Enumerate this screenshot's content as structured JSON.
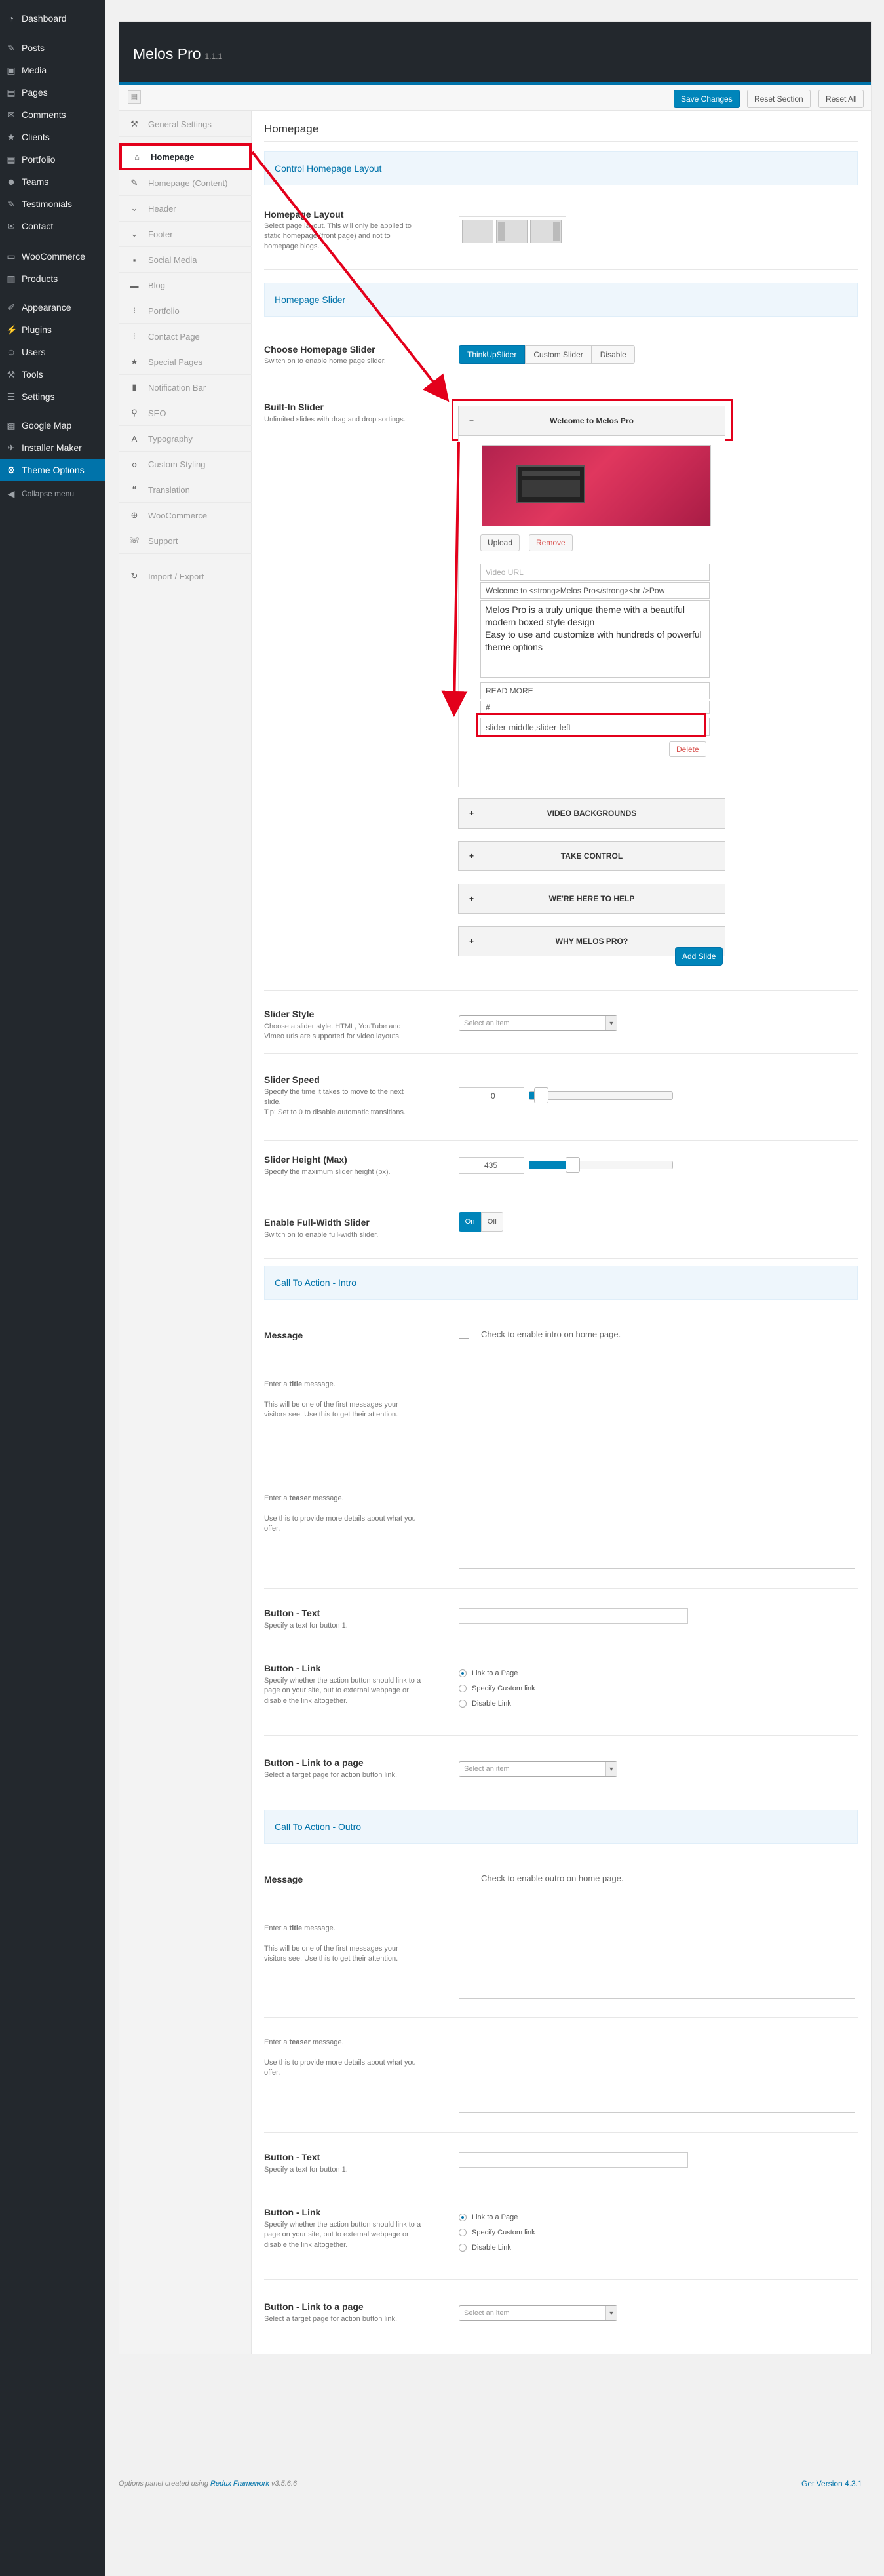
{
  "wp_menu": {
    "items": [
      {
        "label": "Dashboard",
        "icon": "dashboard-icon"
      },
      {
        "label": "Posts",
        "icon": "pin-icon"
      },
      {
        "label": "Media",
        "icon": "media-icon"
      },
      {
        "label": "Pages",
        "icon": "page-icon"
      },
      {
        "label": "Comments",
        "icon": "comment-icon"
      },
      {
        "label": "Clients",
        "icon": "star-icon"
      },
      {
        "label": "Portfolio",
        "icon": "portfolio-icon"
      },
      {
        "label": "Teams",
        "icon": "team-icon"
      },
      {
        "label": "Testimonials",
        "icon": "pin-icon"
      },
      {
        "label": "Contact",
        "icon": "mail-icon"
      },
      {
        "label": "WooCommerce",
        "icon": "woo-icon"
      },
      {
        "label": "Products",
        "icon": "products-icon"
      },
      {
        "label": "Appearance",
        "icon": "brush-icon"
      },
      {
        "label": "Plugins",
        "icon": "plugin-icon"
      },
      {
        "label": "Users",
        "icon": "user-icon"
      },
      {
        "label": "Tools",
        "icon": "wrench-icon"
      },
      {
        "label": "Settings",
        "icon": "settings-icon"
      },
      {
        "label": "Google Map",
        "icon": "map-icon"
      },
      {
        "label": "Installer Maker",
        "icon": "installer-icon"
      },
      {
        "label": "Theme Options",
        "icon": "gear-icon"
      },
      {
        "label": "Collapse menu",
        "icon": "collapse-icon"
      }
    ]
  },
  "header": {
    "title": "Melos Pro",
    "version": "1.1.1"
  },
  "toolbar": {
    "save": "Save Changes",
    "reset_section": "Reset Section",
    "reset_all": "Reset All"
  },
  "nav": {
    "items": [
      {
        "label": "General Settings",
        "icon": "wrench-icon"
      },
      {
        "label": "Homepage",
        "icon": "home-icon"
      },
      {
        "label": "Homepage (Content)",
        "icon": "pencil-icon"
      },
      {
        "label": "Header",
        "icon": "chevron-down-icon"
      },
      {
        "label": "Footer",
        "icon": "chevron-down-icon"
      },
      {
        "label": "Social Media",
        "icon": "social-icon"
      },
      {
        "label": "Blog",
        "icon": "comment-icon"
      },
      {
        "label": "Portfolio",
        "icon": "grid-icon"
      },
      {
        "label": "Contact Page",
        "icon": "grid-icon"
      },
      {
        "label": "Special Pages",
        "icon": "star-icon"
      },
      {
        "label": "Notification Bar",
        "icon": "bell-icon"
      },
      {
        "label": "SEO",
        "icon": "search-icon"
      },
      {
        "label": "Typography",
        "icon": "type-icon"
      },
      {
        "label": "Custom Styling",
        "icon": "code-icon"
      },
      {
        "label": "Translation",
        "icon": "quote-icon"
      },
      {
        "label": "WooCommerce",
        "icon": "cart-icon"
      },
      {
        "label": "Support",
        "icon": "support-icon"
      },
      {
        "label": "Import / Export",
        "icon": "refresh-icon"
      }
    ]
  },
  "main": {
    "page_title": "Homepage",
    "section_layout": "Control Homepage Layout",
    "layout_title": "Homepage Layout",
    "layout_desc": "Select page layout. This will only be applied to static homepage (front page) and not to homepage blogs.",
    "section_slider": "Homepage Slider",
    "choose_title": "Choose Homepage Slider",
    "choose_desc": "Switch on to enable home page slider.",
    "choose_options": [
      "ThinkUpSlider",
      "Custom Slider",
      "Disable"
    ],
    "builtin_title": "Built-In Slider",
    "builtin_desc": "Unlimited slides with drag and drop sortings.",
    "slide_open": "Welcome to Melos Pro",
    "upload": "Upload",
    "remove": "Remove",
    "video_placeholder": "Video URL",
    "slide_title_value": "Welcome to <strong>Melos Pro</strong><br />Pow",
    "slide_desc_value": "Melos Pro is a truly unique theme with a beautiful modern boxed style design\nEasy to use and customize with hundreds of powerful theme options",
    "slide_button_value": "READ MORE",
    "slide_link_value": "#",
    "slide_class_value": "slider-middle,slider-left",
    "delete": "Delete",
    "slides_collapsed": [
      "VIDEO BACKGROUNDS",
      "TAKE CONTROL",
      "WE'RE HERE TO HELP",
      "WHY MELOS PRO?"
    ],
    "add_slide": "Add Slide",
    "style_title": "Slider Style",
    "style_desc": "Choose a slider style. HTML, YouTube and Vimeo urls are supported for video layouts.",
    "select_placeholder": "Select an item",
    "speed_title": "Slider Speed",
    "speed_desc": "Specify the time it takes to move to the next slide.\nTip: Set to 0 to disable automatic transitions.",
    "speed_value": "0",
    "speed_fraction": 0,
    "height_title": "Slider Height (Max)",
    "height_desc": "Specify the maximum slider height (px).",
    "height_value": "435",
    "height_fraction": 0.25,
    "fullwidth_title": "Enable Full-Width Slider",
    "fullwidth_desc": "Switch on to enable full-width slider.",
    "on": "On",
    "off": "Off",
    "section_intro": "Call To Action - Intro",
    "message_title": "Message",
    "intro_check": "Check to enable intro on home page.",
    "title_msg_desc_a": "Enter a ",
    "title_msg_desc_b": "title",
    "title_msg_desc_c": " message.",
    "title_msg_desc2": "This will be one of the first messages your visitors see. Use this to get their attention.",
    "teaser_desc_a": "Enter a ",
    "teaser_desc_b": "teaser",
    "teaser_desc_c": " message.",
    "teaser_desc2": "Use this to provide more details about what you offer.",
    "btn_text_title": "Button - Text",
    "btn_text_desc": "Specify a text for button 1.",
    "btn_link_title": "Button - Link",
    "btn_link_desc": "Specify whether the action button should link to a page on your site, out to external webpage or disable the link altogether.",
    "link_options": [
      "Link to a Page",
      "Specify Custom link",
      "Disable Link"
    ],
    "btn_page_title": "Button - Link to a page",
    "btn_page_desc": "Select a target page for action button link.",
    "section_outro": "Call To Action - Outro",
    "outro_check": "Check to enable outro on home page."
  },
  "footer": {
    "credit_a": "Options panel created using ",
    "credit_link": "Redux Framework",
    "credit_b": " v3.5.6.6",
    "get_version": "Get Version 4.3.1"
  },
  "colors": {
    "accent": "#0073aa",
    "highlight": "#e3001b",
    "admin_bg": "#23282d"
  }
}
